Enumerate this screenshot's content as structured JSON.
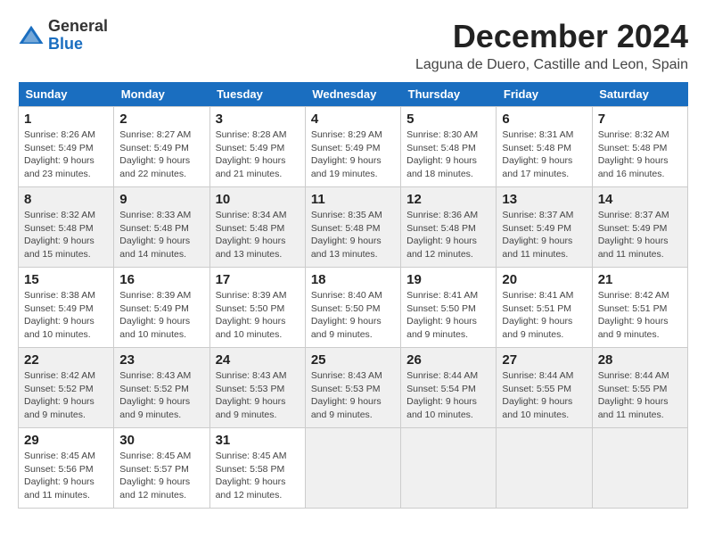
{
  "header": {
    "logo_general": "General",
    "logo_blue": "Blue",
    "month_title": "December 2024",
    "location": "Laguna de Duero, Castille and Leon, Spain"
  },
  "weekdays": [
    "Sunday",
    "Monday",
    "Tuesday",
    "Wednesday",
    "Thursday",
    "Friday",
    "Saturday"
  ],
  "days": [
    {
      "day": "",
      "empty": true
    },
    {
      "day": "",
      "empty": true
    },
    {
      "day": "",
      "empty": true
    },
    {
      "day": "",
      "empty": true
    },
    {
      "day": "",
      "empty": true
    },
    {
      "day": "",
      "empty": true
    },
    {
      "day": "1",
      "sunrise": "Sunrise: 8:26 AM",
      "sunset": "Sunset: 5:49 PM",
      "daylight": "Daylight: 9 hours and 23 minutes."
    },
    {
      "day": "2",
      "sunrise": "Sunrise: 8:27 AM",
      "sunset": "Sunset: 5:49 PM",
      "daylight": "Daylight: 9 hours and 22 minutes."
    },
    {
      "day": "3",
      "sunrise": "Sunrise: 8:28 AM",
      "sunset": "Sunset: 5:49 PM",
      "daylight": "Daylight: 9 hours and 21 minutes."
    },
    {
      "day": "4",
      "sunrise": "Sunrise: 8:29 AM",
      "sunset": "Sunset: 5:49 PM",
      "daylight": "Daylight: 9 hours and 19 minutes."
    },
    {
      "day": "5",
      "sunrise": "Sunrise: 8:30 AM",
      "sunset": "Sunset: 5:48 PM",
      "daylight": "Daylight: 9 hours and 18 minutes."
    },
    {
      "day": "6",
      "sunrise": "Sunrise: 8:31 AM",
      "sunset": "Sunset: 5:48 PM",
      "daylight": "Daylight: 9 hours and 17 minutes."
    },
    {
      "day": "7",
      "sunrise": "Sunrise: 8:32 AM",
      "sunset": "Sunset: 5:48 PM",
      "daylight": "Daylight: 9 hours and 16 minutes."
    },
    {
      "day": "8",
      "sunrise": "Sunrise: 8:32 AM",
      "sunset": "Sunset: 5:48 PM",
      "daylight": "Daylight: 9 hours and 15 minutes."
    },
    {
      "day": "9",
      "sunrise": "Sunrise: 8:33 AM",
      "sunset": "Sunset: 5:48 PM",
      "daylight": "Daylight: 9 hours and 14 minutes."
    },
    {
      "day": "10",
      "sunrise": "Sunrise: 8:34 AM",
      "sunset": "Sunset: 5:48 PM",
      "daylight": "Daylight: 9 hours and 13 minutes."
    },
    {
      "day": "11",
      "sunrise": "Sunrise: 8:35 AM",
      "sunset": "Sunset: 5:48 PM",
      "daylight": "Daylight: 9 hours and 13 minutes."
    },
    {
      "day": "12",
      "sunrise": "Sunrise: 8:36 AM",
      "sunset": "Sunset: 5:48 PM",
      "daylight": "Daylight: 9 hours and 12 minutes."
    },
    {
      "day": "13",
      "sunrise": "Sunrise: 8:37 AM",
      "sunset": "Sunset: 5:49 PM",
      "daylight": "Daylight: 9 hours and 11 minutes."
    },
    {
      "day": "14",
      "sunrise": "Sunrise: 8:37 AM",
      "sunset": "Sunset: 5:49 PM",
      "daylight": "Daylight: 9 hours and 11 minutes."
    },
    {
      "day": "15",
      "sunrise": "Sunrise: 8:38 AM",
      "sunset": "Sunset: 5:49 PM",
      "daylight": "Daylight: 9 hours and 10 minutes."
    },
    {
      "day": "16",
      "sunrise": "Sunrise: 8:39 AM",
      "sunset": "Sunset: 5:49 PM",
      "daylight": "Daylight: 9 hours and 10 minutes."
    },
    {
      "day": "17",
      "sunrise": "Sunrise: 8:39 AM",
      "sunset": "Sunset: 5:50 PM",
      "daylight": "Daylight: 9 hours and 10 minutes."
    },
    {
      "day": "18",
      "sunrise": "Sunrise: 8:40 AM",
      "sunset": "Sunset: 5:50 PM",
      "daylight": "Daylight: 9 hours and 9 minutes."
    },
    {
      "day": "19",
      "sunrise": "Sunrise: 8:41 AM",
      "sunset": "Sunset: 5:50 PM",
      "daylight": "Daylight: 9 hours and 9 minutes."
    },
    {
      "day": "20",
      "sunrise": "Sunrise: 8:41 AM",
      "sunset": "Sunset: 5:51 PM",
      "daylight": "Daylight: 9 hours and 9 minutes."
    },
    {
      "day": "21",
      "sunrise": "Sunrise: 8:42 AM",
      "sunset": "Sunset: 5:51 PM",
      "daylight": "Daylight: 9 hours and 9 minutes."
    },
    {
      "day": "22",
      "sunrise": "Sunrise: 8:42 AM",
      "sunset": "Sunset: 5:52 PM",
      "daylight": "Daylight: 9 hours and 9 minutes."
    },
    {
      "day": "23",
      "sunrise": "Sunrise: 8:43 AM",
      "sunset": "Sunset: 5:52 PM",
      "daylight": "Daylight: 9 hours and 9 minutes."
    },
    {
      "day": "24",
      "sunrise": "Sunrise: 8:43 AM",
      "sunset": "Sunset: 5:53 PM",
      "daylight": "Daylight: 9 hours and 9 minutes."
    },
    {
      "day": "25",
      "sunrise": "Sunrise: 8:43 AM",
      "sunset": "Sunset: 5:53 PM",
      "daylight": "Daylight: 9 hours and 9 minutes."
    },
    {
      "day": "26",
      "sunrise": "Sunrise: 8:44 AM",
      "sunset": "Sunset: 5:54 PM",
      "daylight": "Daylight: 9 hours and 10 minutes."
    },
    {
      "day": "27",
      "sunrise": "Sunrise: 8:44 AM",
      "sunset": "Sunset: 5:55 PM",
      "daylight": "Daylight: 9 hours and 10 minutes."
    },
    {
      "day": "28",
      "sunrise": "Sunrise: 8:44 AM",
      "sunset": "Sunset: 5:55 PM",
      "daylight": "Daylight: 9 hours and 11 minutes."
    },
    {
      "day": "29",
      "sunrise": "Sunrise: 8:45 AM",
      "sunset": "Sunset: 5:56 PM",
      "daylight": "Daylight: 9 hours and 11 minutes."
    },
    {
      "day": "30",
      "sunrise": "Sunrise: 8:45 AM",
      "sunset": "Sunset: 5:57 PM",
      "daylight": "Daylight: 9 hours and 12 minutes."
    },
    {
      "day": "31",
      "sunrise": "Sunrise: 8:45 AM",
      "sunset": "Sunset: 5:58 PM",
      "daylight": "Daylight: 9 hours and 12 minutes."
    },
    {
      "day": "",
      "empty": true
    },
    {
      "day": "",
      "empty": true
    },
    {
      "day": "",
      "empty": true
    },
    {
      "day": "",
      "empty": true
    }
  ]
}
